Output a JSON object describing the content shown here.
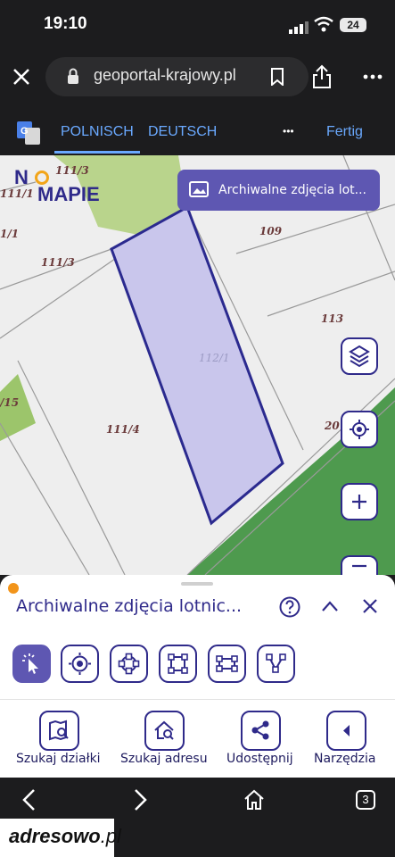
{
  "status_bar": {
    "time": "19:10",
    "battery": "24"
  },
  "browser": {
    "url": "geoportal-krajowy.pl"
  },
  "translate_bar": {
    "lang_from": "POLNISCH",
    "lang_to": "DEUTSCH",
    "more": "•••",
    "done": "Fertig"
  },
  "map": {
    "logo_text_1": "N",
    "logo_text_2": "MAPIE",
    "banner_label": "Archiwalne zdjęcia lot...",
    "parcels": [
      "111/3",
      "111/1",
      "1/1",
      "111/3",
      "109",
      "113",
      "112/1",
      "/15",
      "111/4",
      "20"
    ],
    "parcel_selected_color": "#c9c6ec",
    "parcel_outline_color": "#2b2a8f"
  },
  "sheet": {
    "title": "Archiwalne zdjęcia lotnic...",
    "tools": [
      "select-tool",
      "point-tool",
      "circle-tool",
      "rectangle-tool",
      "rectangle-alt-tool",
      "polyline-tool"
    ],
    "nav": [
      {
        "label": "Szukaj działki",
        "icon": "map-search-icon"
      },
      {
        "label": "Szukaj adresu",
        "icon": "house-search-icon"
      },
      {
        "label": "Udostępnij",
        "icon": "share-icon"
      },
      {
        "label": "Narzędzia",
        "icon": "chevron-left-icon"
      }
    ]
  },
  "safari_bar": {
    "tabs_count": "3"
  },
  "watermark": {
    "text_bold": "adresowo",
    "text_suffix": ".pl"
  },
  "colors": {
    "accent": "#2f2a8a",
    "accent_fill": "#5e57b2",
    "forest": "#4e9a4e"
  }
}
